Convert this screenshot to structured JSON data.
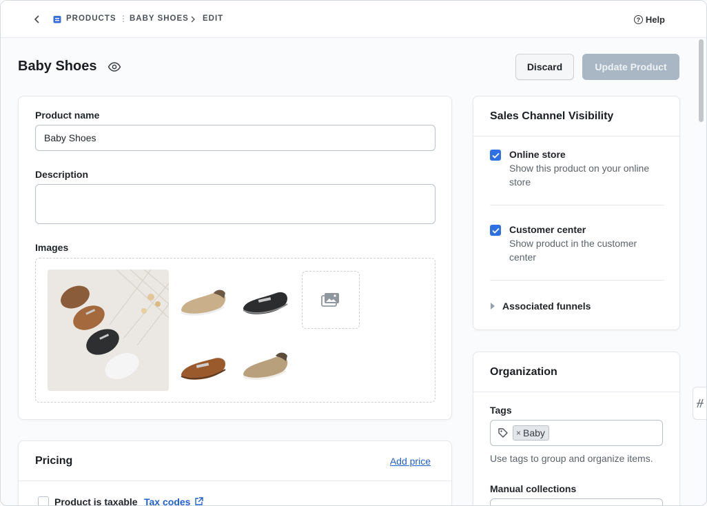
{
  "nav": {
    "breadcrumb": [
      "PRODUCTS",
      "BABY SHOES",
      "EDIT"
    ],
    "help_label": "Help"
  },
  "header": {
    "title": "Baby Shoes",
    "discard_label": "Discard",
    "update_label": "Update Product"
  },
  "product_card": {
    "name_label": "Product name",
    "name_value": "Baby Shoes",
    "description_label": "Description",
    "description_value": "",
    "images_label": "Images",
    "images": [
      "baby-shoes-group-photo",
      "beige-slip-on-shoe",
      "black-loafer-shoe",
      "brown-loafer-shoe",
      "gold-slip-on-shoe"
    ]
  },
  "pricing_card": {
    "title": "Pricing",
    "add_price_label": "Add price",
    "taxable_label": "Product is taxable",
    "tax_codes_label": "Tax codes"
  },
  "sales_channel": {
    "title": "Sales Channel Visibility",
    "options": [
      {
        "title": "Online store",
        "desc": "Show this product on your online store",
        "checked": true
      },
      {
        "title": "Customer center",
        "desc": "Show product in the customer center",
        "checked": true
      }
    ],
    "funnels_label": "Associated funnels"
  },
  "organization": {
    "title": "Organization",
    "tags_label": "Tags",
    "tags": [
      "Baby"
    ],
    "tags_help": "Use tags to group and organize items.",
    "collections_label": "Manual collections"
  },
  "colors": {
    "accent": "#2f6fe4",
    "link": "#1f5fd0",
    "update_disabled": "#a9b6c3"
  }
}
